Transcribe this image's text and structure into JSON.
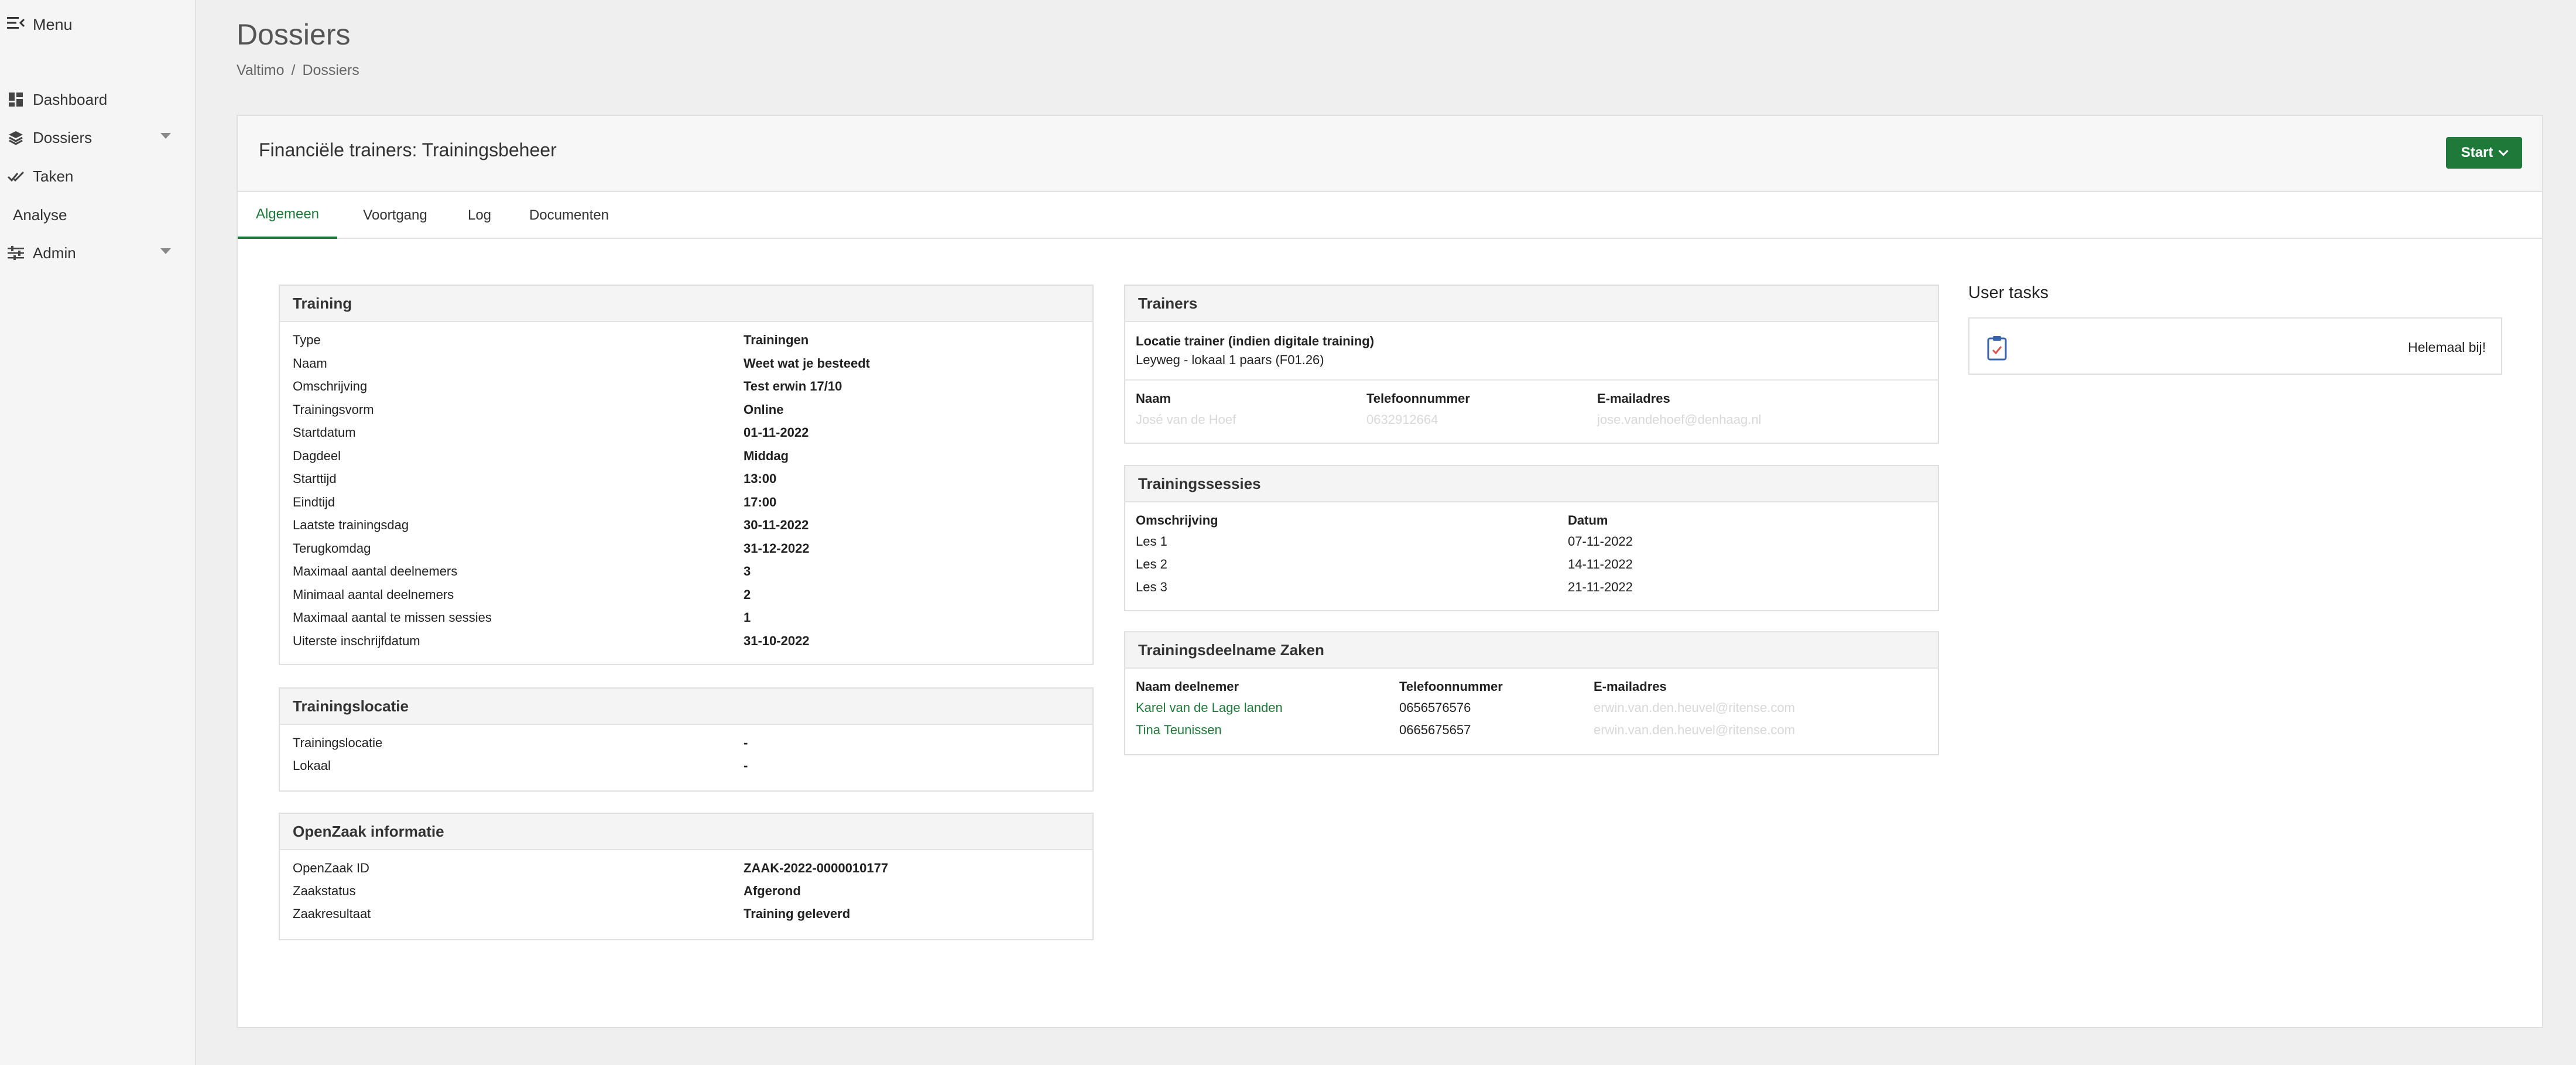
{
  "sidebar": {
    "menu_label": "Menu",
    "items": [
      {
        "label": "Dashboard",
        "icon": "dashboard-icon"
      },
      {
        "label": "Dossiers",
        "icon": "layers-icon"
      },
      {
        "label": "Taken",
        "icon": "check-icon"
      },
      {
        "label": "Analyse",
        "icon": ""
      },
      {
        "label": "Admin",
        "icon": "sliders-icon"
      }
    ]
  },
  "header": {
    "title": "Dossiers",
    "breadcrumb": [
      "Valtimo",
      "/",
      "Dossiers"
    ]
  },
  "card": {
    "title": "Financiële trainers: Trainingsbeheer",
    "start_label": "Start",
    "tabs": [
      "Algemeen",
      "Voortgang",
      "Log",
      "Documenten"
    ]
  },
  "training": {
    "title": "Training",
    "rows": [
      {
        "label": "Type",
        "value": "Trainingen"
      },
      {
        "label": "Naam",
        "value": "Weet wat je besteedt"
      },
      {
        "label": "Omschrijving",
        "value": "Test erwin 17/10"
      },
      {
        "label": "Trainingsvorm",
        "value": "Online"
      },
      {
        "label": "Startdatum",
        "value": "01-11-2022"
      },
      {
        "label": "Dagdeel",
        "value": "Middag"
      },
      {
        "label": "Starttijd",
        "value": "13:00"
      },
      {
        "label": "Eindtijd",
        "value": "17:00"
      },
      {
        "label": "Laatste trainingsdag",
        "value": "30-11-2022"
      },
      {
        "label": "Terugkomdag",
        "value": "31-12-2022"
      },
      {
        "label": "Maximaal aantal deelnemers",
        "value": "3"
      },
      {
        "label": "Minimaal aantal deelnemers",
        "value": "2"
      },
      {
        "label": "Maximaal aantal te missen sessies",
        "value": "1"
      },
      {
        "label": "Uiterste inschrijfdatum",
        "value": "31-10-2022"
      }
    ]
  },
  "locatie": {
    "title": "Trainingslocatie",
    "rows": [
      {
        "label": "Trainingslocatie",
        "value": "-"
      },
      {
        "label": "Lokaal",
        "value": "-"
      }
    ]
  },
  "openzaak": {
    "title": "OpenZaak informatie",
    "rows": [
      {
        "label": "OpenZaak ID",
        "value": "ZAAK-2022-0000010177"
      },
      {
        "label": "Zaakstatus",
        "value": "Afgerond"
      },
      {
        "label": "Zaakresultaat",
        "value": "Training geleverd"
      }
    ]
  },
  "trainers": {
    "title": "Trainers",
    "location_label": "Locatie trainer (indien digitale training)",
    "location_value": "Leyweg - lokaal 1 paars (F01.26)",
    "headers": [
      "Naam",
      "Telefoonnummer",
      "E-mailadres"
    ],
    "row": [
      "José van de Hoef",
      "0632912664",
      "jose.vandehoef@denhaag.nl"
    ]
  },
  "sessies": {
    "title": "Trainingssessies",
    "headers": [
      "Omschrijving",
      "Datum"
    ],
    "rows": [
      [
        "Les 1",
        "07-11-2022"
      ],
      [
        "Les 2",
        "14-11-2022"
      ],
      [
        "Les 3",
        "21-11-2022"
      ]
    ]
  },
  "deelname": {
    "title": "Trainingsdeelname Zaken",
    "headers": [
      "Naam deelnemer",
      "Telefoonnummer",
      "E-mailadres"
    ],
    "rows": [
      [
        "Karel van de Lage landen",
        "0656576576",
        "erwin.van.den.heuvel@ritense.com"
      ],
      [
        "Tina Teunissen",
        "0665675657",
        "erwin.van.den.heuvel@ritense.com"
      ]
    ]
  },
  "user_tasks": {
    "title": "User tasks",
    "task_label": "Helemaal bij!",
    "task_icon": "clipboard-check-icon"
  },
  "colors": {
    "accent": "#1f7a3a"
  }
}
